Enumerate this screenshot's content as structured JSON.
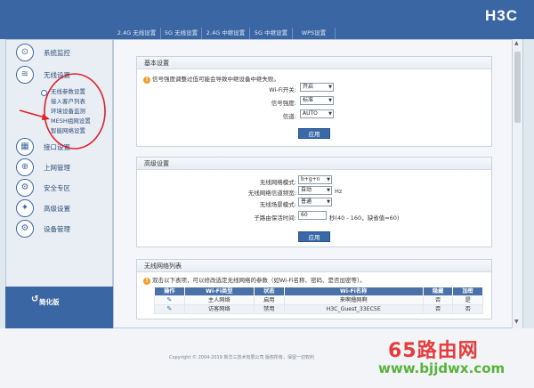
{
  "brand": "H3C",
  "tabs": [
    {
      "label": "2.4G 无线设置",
      "active": true
    },
    {
      "label": "5G 无线设置",
      "active": false
    },
    {
      "label": "2.4G 中继设置",
      "active": false
    },
    {
      "label": "5G 中继设置",
      "active": false
    },
    {
      "label": "WPS设置",
      "active": false
    }
  ],
  "sidebar": {
    "items": [
      {
        "label": "系统监控",
        "icon": "monitor-icon"
      },
      {
        "label": "无线设置",
        "icon": "wifi-icon"
      },
      {
        "label": "接口设置",
        "icon": "interface-icon"
      },
      {
        "label": "上网管理",
        "icon": "network-icon"
      },
      {
        "label": "安全专区",
        "icon": "security-icon"
      },
      {
        "label": "高级设置",
        "icon": "advanced-icon"
      },
      {
        "label": "设备管理",
        "icon": "device-icon"
      }
    ],
    "submenu": [
      {
        "label": "无线参数设置",
        "active": true
      },
      {
        "label": "接入客户列表",
        "active": false
      },
      {
        "label": "环境设备监测",
        "active": false
      },
      {
        "label": "MESH组网设置",
        "active": false
      },
      {
        "label": "智能网络设置",
        "active": false
      }
    ],
    "simple_mode": "简化版"
  },
  "basic": {
    "title": "基本设置",
    "warning": "信号强度调整过低可能会导致中继设备中继失败。",
    "wifi_switch_label": "Wi-Fi开关:",
    "wifi_switch_value": "开启",
    "signal_label": "信号强度:",
    "signal_value": "标准",
    "channel_label": "信道:",
    "channel_value": "AUTO",
    "apply": "应用"
  },
  "advanced": {
    "title": "高级设置",
    "mode_label": "无线网络模式:",
    "mode_value": "b+g+n",
    "bandwidth_label": "无线网络信道频宽:",
    "bandwidth_value": "自动",
    "bandwidth_unit": "Hz",
    "scene_label": "无线场景模式:",
    "scene_value": "普通",
    "keepalive_label": "子路由保活时间:",
    "keepalive_value": "60",
    "keepalive_hint": "秒(40 - 160，缺省值=60)",
    "apply": "应用"
  },
  "wlan_list": {
    "title": "无线网络列表",
    "tip": "双击以下表项，可以修改选定无线网络的参数（如Wi-Fi名称、密码、是否加密等）。",
    "headers": [
      "操作",
      "Wi-Fi类型",
      "状态",
      "Wi-Fi名称",
      "隐藏",
      "加密"
    ],
    "rows": [
      [
        "",
        "主人网络",
        "启用",
        "来啊撸网啊",
        "否",
        "是"
      ],
      [
        "",
        "访客网络",
        "禁用",
        "H3C_Guest_33EC5E",
        "否",
        "否"
      ]
    ]
  },
  "footer": "Copyright © 2004-2019 新华三技术有限公司 版权所有，保留一切权利",
  "watermark": {
    "line1": "65路由网",
    "line2": "www.bjjdwx.com"
  },
  "colors": {
    "header_blue": "#3b66a4",
    "button_blue": "#3a69a8",
    "warning_orange": "#f0a02a",
    "annotation_red": "#e0202a"
  }
}
